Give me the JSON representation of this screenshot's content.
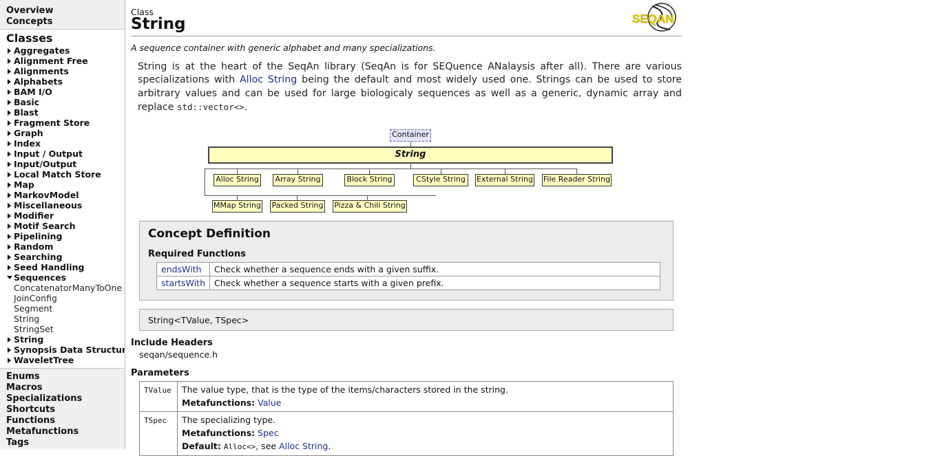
{
  "sidebar": {
    "top_links": [
      "Overview",
      "Concepts"
    ],
    "classes_title": "Classes",
    "classes": [
      {
        "label": "Aggregates",
        "expanded": false
      },
      {
        "label": "Alignment Free",
        "expanded": false
      },
      {
        "label": "Alignments",
        "expanded": false
      },
      {
        "label": "Alphabets",
        "expanded": false
      },
      {
        "label": "BAM I/O",
        "expanded": false
      },
      {
        "label": "Basic",
        "expanded": false
      },
      {
        "label": "Blast",
        "expanded": false
      },
      {
        "label": "Fragment Store",
        "expanded": false
      },
      {
        "label": "Graph",
        "expanded": false
      },
      {
        "label": "Index",
        "expanded": false
      },
      {
        "label": "Input / Output",
        "expanded": false
      },
      {
        "label": "Input/Output",
        "expanded": false
      },
      {
        "label": "Local Match Store",
        "expanded": false
      },
      {
        "label": "Map",
        "expanded": false
      },
      {
        "label": "MarkovModel",
        "expanded": false
      },
      {
        "label": "Miscellaneous",
        "expanded": false
      },
      {
        "label": "Modifier",
        "expanded": false
      },
      {
        "label": "Motif Search",
        "expanded": false
      },
      {
        "label": "Pipelining",
        "expanded": false
      },
      {
        "label": "Random",
        "expanded": false
      },
      {
        "label": "Searching",
        "expanded": false
      },
      {
        "label": "Seed Handling",
        "expanded": false
      },
      {
        "label": "Sequences",
        "expanded": true,
        "children": [
          "ConcatenatorManyToOne",
          "JoinConfig",
          "Segment",
          "String",
          "StringSet"
        ]
      },
      {
        "label": "String",
        "expanded": false
      },
      {
        "label": "Synopsis Data Structures",
        "expanded": false
      },
      {
        "label": "WaveletTree",
        "expanded": false
      }
    ],
    "bottom_links": [
      "Enums",
      "Macros",
      "Specializations",
      "Shortcuts",
      "Functions",
      "Metafunctions",
      "Tags"
    ]
  },
  "header": {
    "kind": "Class",
    "title": "String",
    "logo_text": "SEQAN"
  },
  "brief": "A sequence container with generic alphabet and many specializations.",
  "description": {
    "part1": "String is at the heart of the SeqAn library (SeqAn is for SEQuence ANalaysis after all). There are various specializations with ",
    "link": "Alloc String",
    "part2": " being the default and most widely used one. Strings can be used to store arbitrary values and can be used for large biologicaly sequences as well as a generic, dynamic array and replace ",
    "code": "std::vector<>",
    "part3": "."
  },
  "diagram": {
    "parent": "Container",
    "class": "String",
    "specializations_row1": [
      "Alloc String",
      "Array String",
      "Block String",
      "CStyle String",
      "External String",
      "File Reader String"
    ],
    "specializations_row2": [
      "MMap String",
      "Packed String",
      "Pizza & Chili String"
    ]
  },
  "concept": {
    "title": "Concept Definition",
    "subtitle": "Required Functions",
    "functions": [
      {
        "name": "endsWith",
        "desc": "Check whether a sequence ends with a given suffix."
      },
      {
        "name": "startsWith",
        "desc": "Check whether a sequence starts with a given prefix."
      }
    ]
  },
  "signature": "String<TValue, TSpec>",
  "include": {
    "heading": "Include Headers",
    "value": "seqan/sequence.h"
  },
  "parameters": {
    "heading": "Parameters",
    "metafunctions_label": "Metafunctions:",
    "default_label": "Default:",
    "items": [
      {
        "name": "TValue",
        "desc": "The value type, that is the type of the items/characters stored in the string.",
        "metafunction": "Value"
      },
      {
        "name": "TSpec",
        "desc": "The specializing type.",
        "metafunction": "Spec",
        "default_code": "Alloc<>",
        "default_sep": ", see ",
        "default_link": "Alloc String",
        "default_end": "."
      }
    ]
  },
  "colors": {
    "link": "#1c2e8e",
    "diagram_box": "#ffffc0",
    "panel_bg": "#ececec",
    "logo_yellow": "#e8d400"
  }
}
